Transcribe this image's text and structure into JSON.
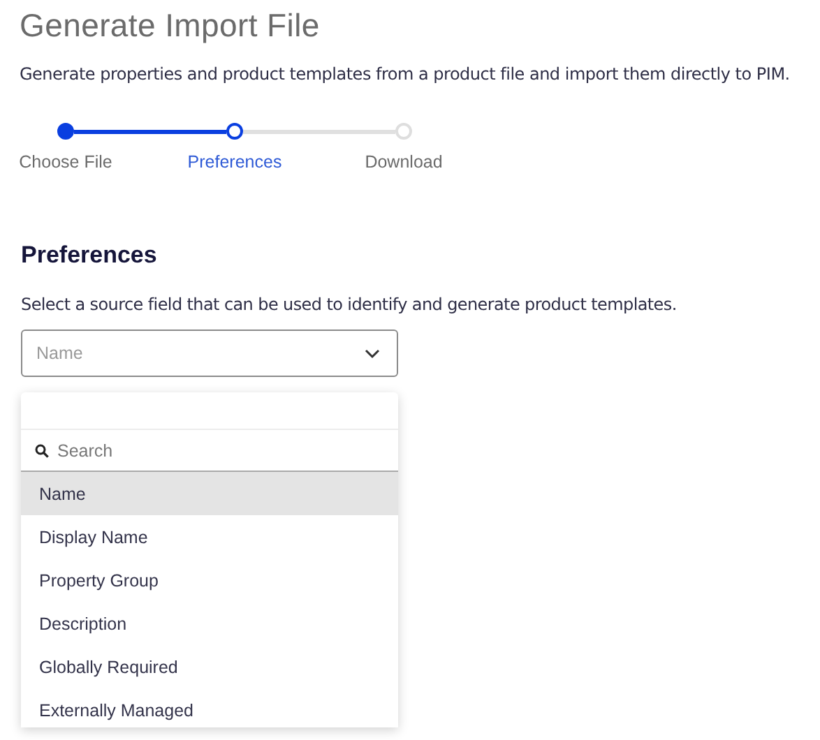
{
  "title": "Generate Import File",
  "description": "Generate properties and product templates from a product file and import them directly to PIM.",
  "steps": [
    {
      "label": "Choose File",
      "completed": true,
      "selected": false
    },
    {
      "label": "Preferences",
      "completed": false,
      "selected": true
    },
    {
      "label": "Download",
      "completed": false,
      "selected": false
    }
  ],
  "section": {
    "heading": "Preferences",
    "hint": "Select a source field that can be used to identify and generate product templates."
  },
  "select": {
    "placeholder": "Name",
    "expanded": true
  },
  "dropdown": {
    "search_placeholder": "Search",
    "options": [
      {
        "label": "Name",
        "selected": true
      },
      {
        "label": "Display Name",
        "selected": false
      },
      {
        "label": "Property Group",
        "selected": false
      },
      {
        "label": "Description",
        "selected": false
      },
      {
        "label": "Globally Required",
        "selected": false
      },
      {
        "label": "Externally Managed",
        "selected": false
      }
    ]
  }
}
